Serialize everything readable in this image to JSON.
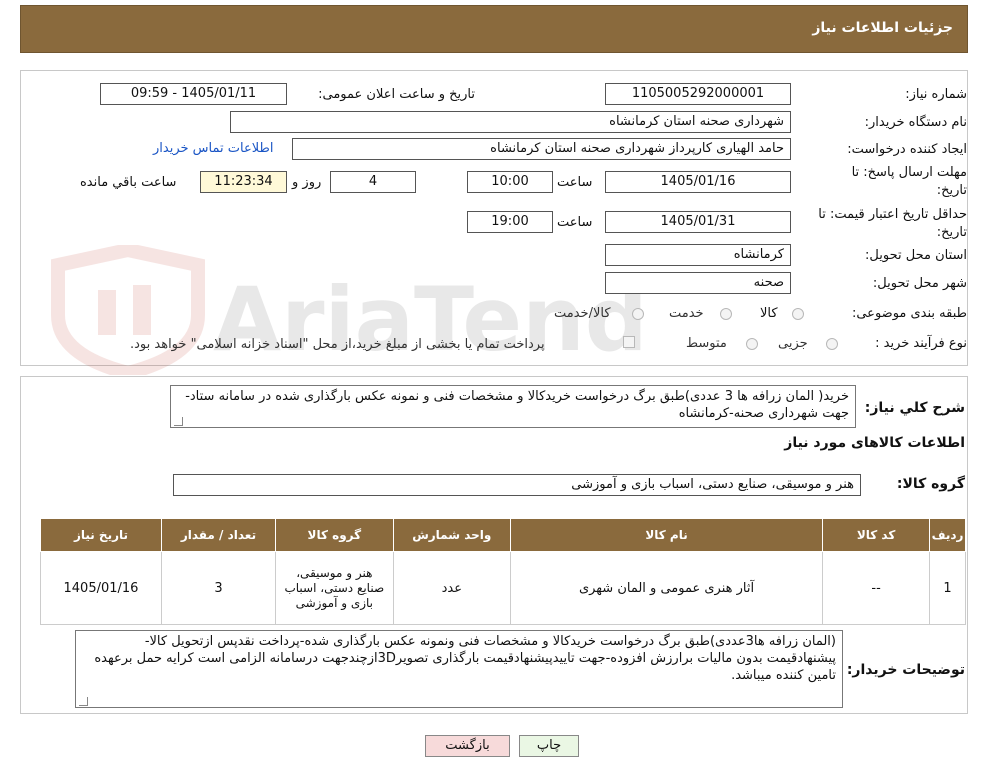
{
  "header": {
    "title": "جزئیات اطلاعات نیاز"
  },
  "watermark": {
    "text": "AriaTender.neT"
  },
  "form": {
    "need_number_label": "شماره نیاز:",
    "need_number": "1105005292000001",
    "announce_label": "تاریخ و ساعت اعلان عمومی:",
    "announce_value": "1405/01/11 - 09:59",
    "buyer_org_label": "نام دستگاه خریدار:",
    "buyer_org": "شهرداری صحنه استان کرمانشاه",
    "creator_label": "ایجاد کننده درخواست:",
    "creator": "حامد الهیاری کارپرداز شهرداری صحنه استان کرمانشاه",
    "contact_link": "اطلاعات تماس خریدار",
    "deadline_label": "مهلت ارسال پاسخ: تا تاریخ:",
    "deadline_date": "1405/01/16",
    "time_label": "ساعت",
    "deadline_time": "10:00",
    "days": "4",
    "days_label": "روز و",
    "remaining": "11:23:34",
    "remaining_label": "ساعت باقي مانده",
    "validity_label": "حداقل تاریخ اعتبار قیمت: تا تاریخ:",
    "validity_date": "1405/01/31",
    "validity_time": "19:00",
    "province_label": "استان محل تحویل:",
    "province": "کرمانشاه",
    "city_label": "شهر محل تحویل:",
    "city": "صحنه",
    "category_label": "طبقه بندی موضوعی:",
    "category_options": [
      "کالا",
      "خدمت",
      "کالا/خدمت"
    ],
    "process_label": "نوع فرآیند خرید :",
    "process_options": [
      "جزیی",
      "متوسط"
    ],
    "payment_note": "پرداخت تمام یا بخشی از مبلغ خرید،از محل \"اسناد خزانه اسلامی\" خواهد بود."
  },
  "description": {
    "label": "شرح کلي نیاز:",
    "text": "خرید( المان زرافه ها 3 عددی)طبق برگ درخواست خریدکالا و مشخصات فنی و نمونه عکس بارگذاری شده در سامانه ستاد-جهت شهرداری صحنه-کرمانشاه"
  },
  "items_section": {
    "title": "اطلاعات کالاهای مورد نیاز",
    "group_label": "گروه کالا:",
    "group_value": "هنر و موسیقی، صنایع دستی، اسباب بازی و آموزشی",
    "columns": [
      "ردیف",
      "کد کالا",
      "نام کالا",
      "واحد شمارش",
      "گروه کالا",
      "تعداد / مقدار",
      "تاریخ نیاز"
    ],
    "rows": [
      [
        "1",
        "--",
        "آثار هنری عمومی و المان شهری",
        "عدد",
        "هنر و موسیقی، صنایع دستی، اسباب بازی و آموزشی",
        "3",
        "1405/01/16"
      ]
    ]
  },
  "buyer_notes": {
    "label": "توضیحات خریدار:",
    "text": "(المان زرافه ها3عددی)طبق برگ درخواست خریدکالا و مشخصات فنی ونمونه عکس بارگذاری شده-پرداخت نقدپس ازتحویل کالا-پیشنهادقیمت بدون مالیات برارزش افزوده-جهت تاییدپیشنهادقیمت بارگذاری تصویر3Dازچندجهت درسامانه الزامی است کرایه حمل برعهده تامین کننده میباشد."
  },
  "buttons": {
    "back": "بازگشت",
    "print": "چاپ"
  },
  "colors": {
    "header": "#8a6a3d",
    "link": "#1a55c5",
    "back_button": "#f7dada",
    "print_button": "#eaf7e4"
  }
}
